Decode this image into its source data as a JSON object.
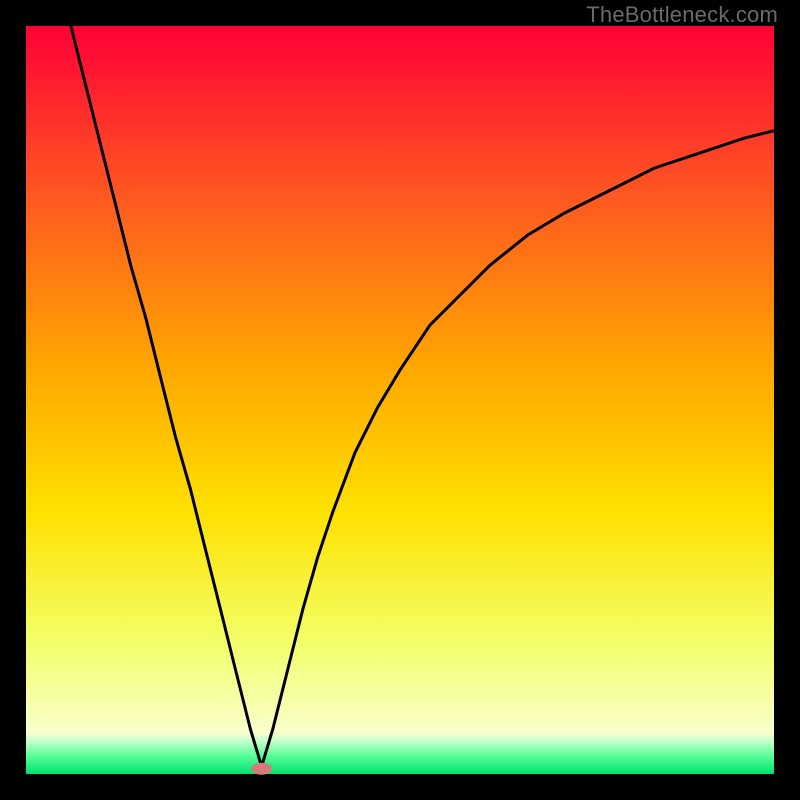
{
  "watermark": "TheBottleneck.com",
  "chart_data": {
    "type": "line",
    "title": "",
    "xlabel": "",
    "ylabel": "",
    "xlim": [
      0,
      100
    ],
    "ylim": [
      0,
      100
    ],
    "legend": false,
    "grid": false,
    "note": "Bottleneck-style V-curve over vertical rainbow gradient; minimum marked by red oval",
    "background_gradient": [
      {
        "pos": 0.0,
        "color": "#ff0036"
      },
      {
        "pos": 0.22,
        "color": "#ff5522"
      },
      {
        "pos": 0.45,
        "color": "#ffa500"
      },
      {
        "pos": 0.65,
        "color": "#ffe100"
      },
      {
        "pos": 0.82,
        "color": "#f3ff66"
      },
      {
        "pos": 0.945,
        "color": "#f9ffcc"
      },
      {
        "pos": 0.955,
        "color": "#c8ffd0"
      },
      {
        "pos": 0.975,
        "color": "#5cff99"
      },
      {
        "pos": 1.0,
        "color": "#00e070"
      }
    ],
    "min_marker": {
      "x": 31.5,
      "y": 0.7,
      "color": "#d97a7a",
      "rx": 1.4,
      "ry": 0.8
    },
    "series": [
      {
        "name": "bottleneck-curve",
        "color": "#000000",
        "x": [
          6,
          8,
          10,
          12,
          14,
          16,
          18,
          20,
          22,
          24,
          26,
          28,
          30,
          31.5,
          33,
          35,
          37,
          39,
          41,
          44,
          47,
          50,
          54,
          58,
          62,
          67,
          72,
          78,
          84,
          90,
          96,
          100
        ],
        "y": [
          100,
          92,
          84,
          76,
          68,
          61,
          53,
          45,
          38,
          30,
          22,
          14,
          6,
          1,
          6,
          14,
          22,
          29,
          35,
          43,
          49,
          54,
          60,
          64,
          68,
          72,
          75,
          78,
          81,
          83,
          85,
          86
        ]
      }
    ]
  }
}
